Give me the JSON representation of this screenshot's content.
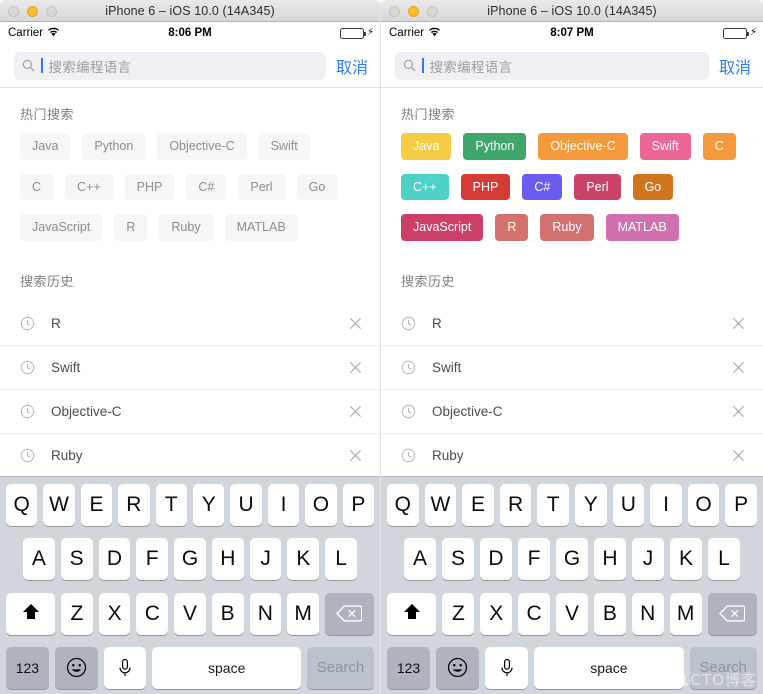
{
  "window": {
    "title": "iPhone 6 – iOS 10.0 (14A345)",
    "traffic_lights": [
      "close-button",
      "minimize-button",
      "zoom-button"
    ]
  },
  "status_bar": {
    "carrier": "Carrier",
    "wifi_icon": "wifi-icon",
    "time_left": "8:06 PM",
    "time_right": "8:07 PM",
    "battery_icon": "battery-icon",
    "charging_icon": "charging-bolt-icon",
    "battery_color": "#4cd554"
  },
  "search": {
    "icon": "search-icon",
    "placeholder": "搜索编程语言",
    "value": "",
    "cancel_label": "取消",
    "cancel_color": "#2d7bf6"
  },
  "hot": {
    "title": "热门搜索",
    "tags_plain": [
      "Java",
      "Python",
      "Objective-C",
      "Swift",
      "C",
      "C++",
      "PHP",
      "C#",
      "Perl",
      "Go",
      "JavaScript",
      "R",
      "Ruby",
      "MATLAB"
    ],
    "tags_colored": [
      {
        "label": "Java",
        "color": "#f5cc44"
      },
      {
        "label": "Python",
        "color": "#3fa76b"
      },
      {
        "label": "Objective-C",
        "color": "#f59a3c"
      },
      {
        "label": "Swift",
        "color": "#ee6699"
      },
      {
        "label": "C",
        "color": "#f59a3c"
      },
      {
        "label": "C++",
        "color": "#4ed1c6"
      },
      {
        "label": "PHP",
        "color": "#d63a35"
      },
      {
        "label": "C#",
        "color": "#6a5cee"
      },
      {
        "label": "Perl",
        "color": "#c94368"
      },
      {
        "label": "Go",
        "color": "#d2761e"
      },
      {
        "label": "JavaScript",
        "color": "#cc3f66"
      },
      {
        "label": "R",
        "color": "#d2716e"
      },
      {
        "label": "Ruby",
        "color": "#d2716e"
      },
      {
        "label": "MATLAB",
        "color": "#d070ae"
      }
    ],
    "plain_bg": "#f6f6f6",
    "plain_text": "#8d8d92"
  },
  "history": {
    "title": "搜索历史",
    "clock_icon": "clock-icon",
    "delete_icon": "close-icon",
    "items": [
      "R",
      "Swift",
      "Objective-C",
      "Ruby"
    ]
  },
  "keyboard": {
    "row1": [
      "Q",
      "W",
      "E",
      "R",
      "T",
      "Y",
      "U",
      "I",
      "O",
      "P"
    ],
    "row2": [
      "A",
      "S",
      "D",
      "F",
      "G",
      "H",
      "J",
      "K",
      "L"
    ],
    "row3": [
      "Z",
      "X",
      "C",
      "V",
      "B",
      "N",
      "M"
    ],
    "shift_icon": "shift-icon",
    "backspace_icon": "backspace-icon",
    "numbers_label": "123",
    "emoji_icon": "emoji-icon",
    "mic_icon": "microphone-icon",
    "space_label": "space",
    "search_label": "Search",
    "bg_color": "#d1d5dc",
    "gray_key_color": "#aeb3bd"
  },
  "watermark": "@51CTO博客"
}
